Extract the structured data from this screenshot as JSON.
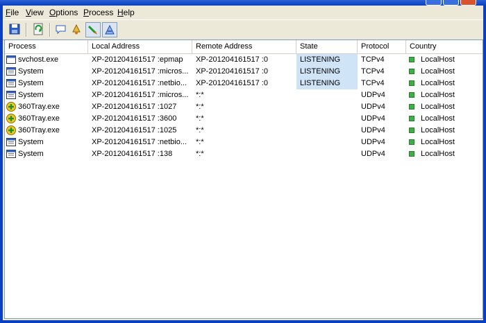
{
  "menu": [
    {
      "key": "F",
      "rest": "ile"
    },
    {
      "key": "V",
      "rest": "iew"
    },
    {
      "key": "O",
      "rest": "ptions"
    },
    {
      "key": "P",
      "rest": "rocess"
    },
    {
      "key": "H",
      "rest": "elp"
    }
  ],
  "toolbar": {
    "icons": [
      "save-icon",
      "refresh-icon",
      "comment-icon",
      "alarm-icon",
      "pin-icon",
      "filter-icon"
    ]
  },
  "columns": [
    "Process",
    "Local Address",
    "Remote Address",
    "State",
    "Protocol",
    "Country"
  ],
  "rows": [
    {
      "icon": "window-icon",
      "process": "svchost.exe",
      "local": "XP-201204161517 :epmap",
      "remote": "XP-201204161517 :0",
      "state": "LISTENING",
      "protocol": "TCPv4",
      "country": "LocalHost"
    },
    {
      "icon": "system-icon",
      "process": "System",
      "local": "XP-201204161517 :micros...",
      "remote": "XP-201204161517 :0",
      "state": "LISTENING",
      "protocol": "TCPv4",
      "country": "LocalHost"
    },
    {
      "icon": "system-icon",
      "process": "System",
      "local": "XP-201204161517 :netbio...",
      "remote": "XP-201204161517 :0",
      "state": "LISTENING",
      "protocol": "TCPv4",
      "country": "LocalHost"
    },
    {
      "icon": "system-icon",
      "process": "System",
      "local": "XP-201204161517 :micros...",
      "remote": "*:*",
      "state": "",
      "protocol": "UDPv4",
      "country": "LocalHost"
    },
    {
      "icon": "tray360-icon",
      "process": "360Tray.exe",
      "local": "XP-201204161517 :1027",
      "remote": "*:*",
      "state": "",
      "protocol": "UDPv4",
      "country": "LocalHost"
    },
    {
      "icon": "tray360-icon",
      "process": "360Tray.exe",
      "local": "XP-201204161517 :3600",
      "remote": "*:*",
      "state": "",
      "protocol": "UDPv4",
      "country": "LocalHost"
    },
    {
      "icon": "tray360-icon",
      "process": "360Tray.exe",
      "local": "XP-201204161517 :1025",
      "remote": "*:*",
      "state": "",
      "protocol": "UDPv4",
      "country": "LocalHost"
    },
    {
      "icon": "system-icon",
      "process": "System",
      "local": "XP-201204161517 :netbio...",
      "remote": "*:*",
      "state": "",
      "protocol": "UDPv4",
      "country": "LocalHost"
    },
    {
      "icon": "system-icon",
      "process": "System",
      "local": "XP-201204161517 :138",
      "remote": "*:*",
      "state": "",
      "protocol": "UDPv4",
      "country": "LocalHost"
    }
  ],
  "colors": {
    "titlebar": "#0a3fbf",
    "listening_highlight": "#cfe4f7",
    "country_marker": "#3cb043"
  }
}
